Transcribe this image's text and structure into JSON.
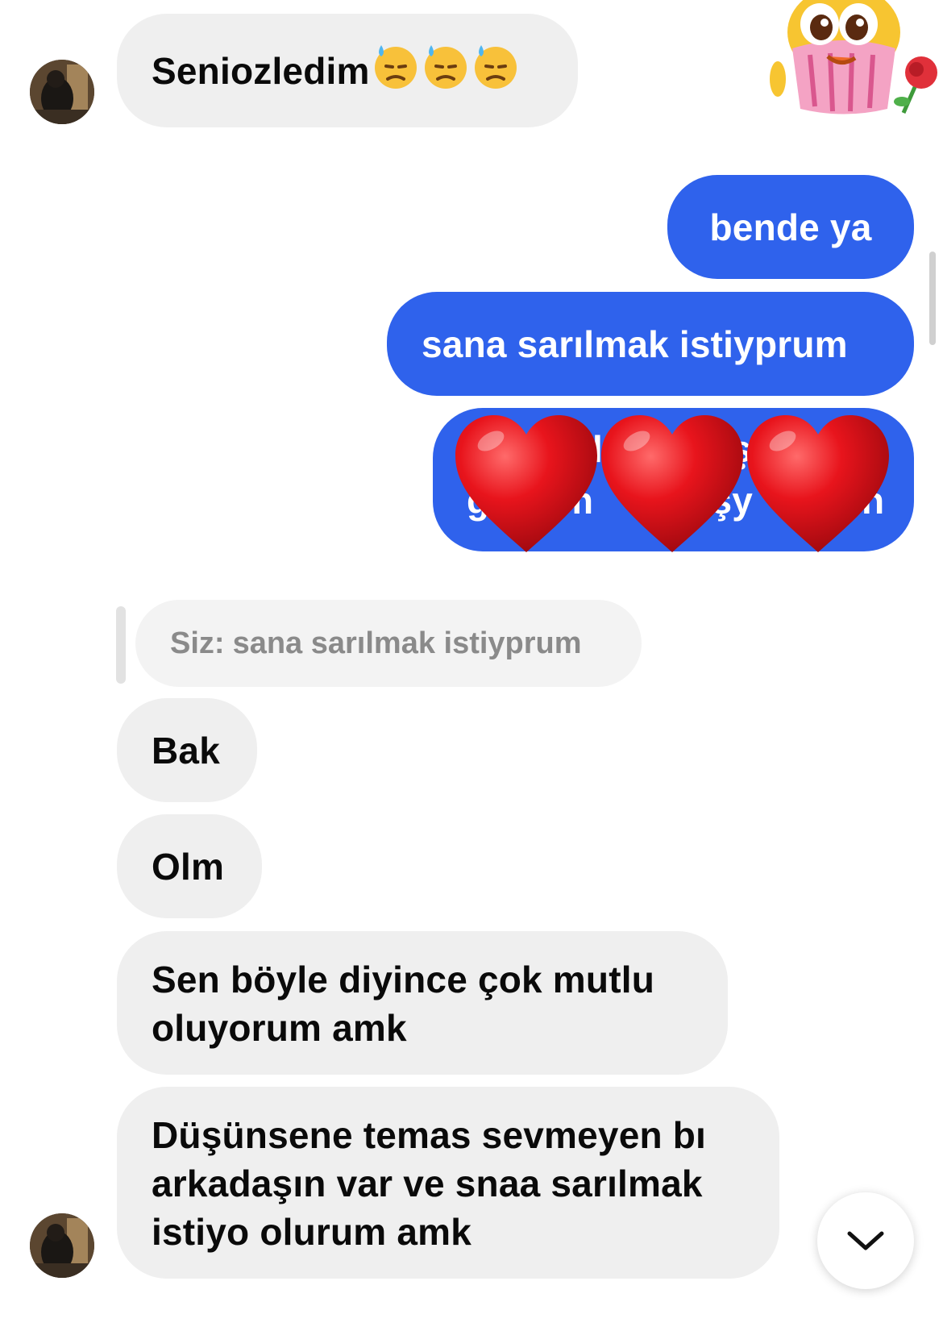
{
  "messages": {
    "m1": {
      "text": "Seniozledim",
      "emojis": [
        "downcast-sweat-face",
        "downcast-sweat-face",
        "downcast-sweat-face"
      ]
    },
    "m2": {
      "text": "bende ya"
    },
    "m3": {
      "text": "sana sarılmak istiyprum"
    },
    "m4": {
      "text_fragments": [
        "l",
        "ş",
        "g",
        "rm",
        "tşy",
        "n"
      ],
      "reaction_overlay": [
        "heart",
        "heart",
        "heart"
      ]
    },
    "reply": {
      "prefix": "Siz:",
      "quoted": "sana sarılmak istiyprum"
    },
    "m5": {
      "text": "Bak"
    },
    "m6": {
      "text": "Olm"
    },
    "m7": {
      "line1": "Sen böyle diyince çok mutlu",
      "line2": "oluyorum amk"
    },
    "m8": {
      "line1": "Düşünsene temas sevmeyen bı",
      "line2": "arkadaşın var ve snaa sarılmak",
      "line3": "istiyo olurum amk"
    }
  },
  "colors": {
    "incoming_bubble": "#efefef",
    "outgoing_bubble": "#2f62ec",
    "heart": "#e8141c"
  },
  "icons": {
    "sticker": "sticker-cupcake-rose",
    "scroll": "chevron-down-icon",
    "avatar": "contact-avatar"
  }
}
